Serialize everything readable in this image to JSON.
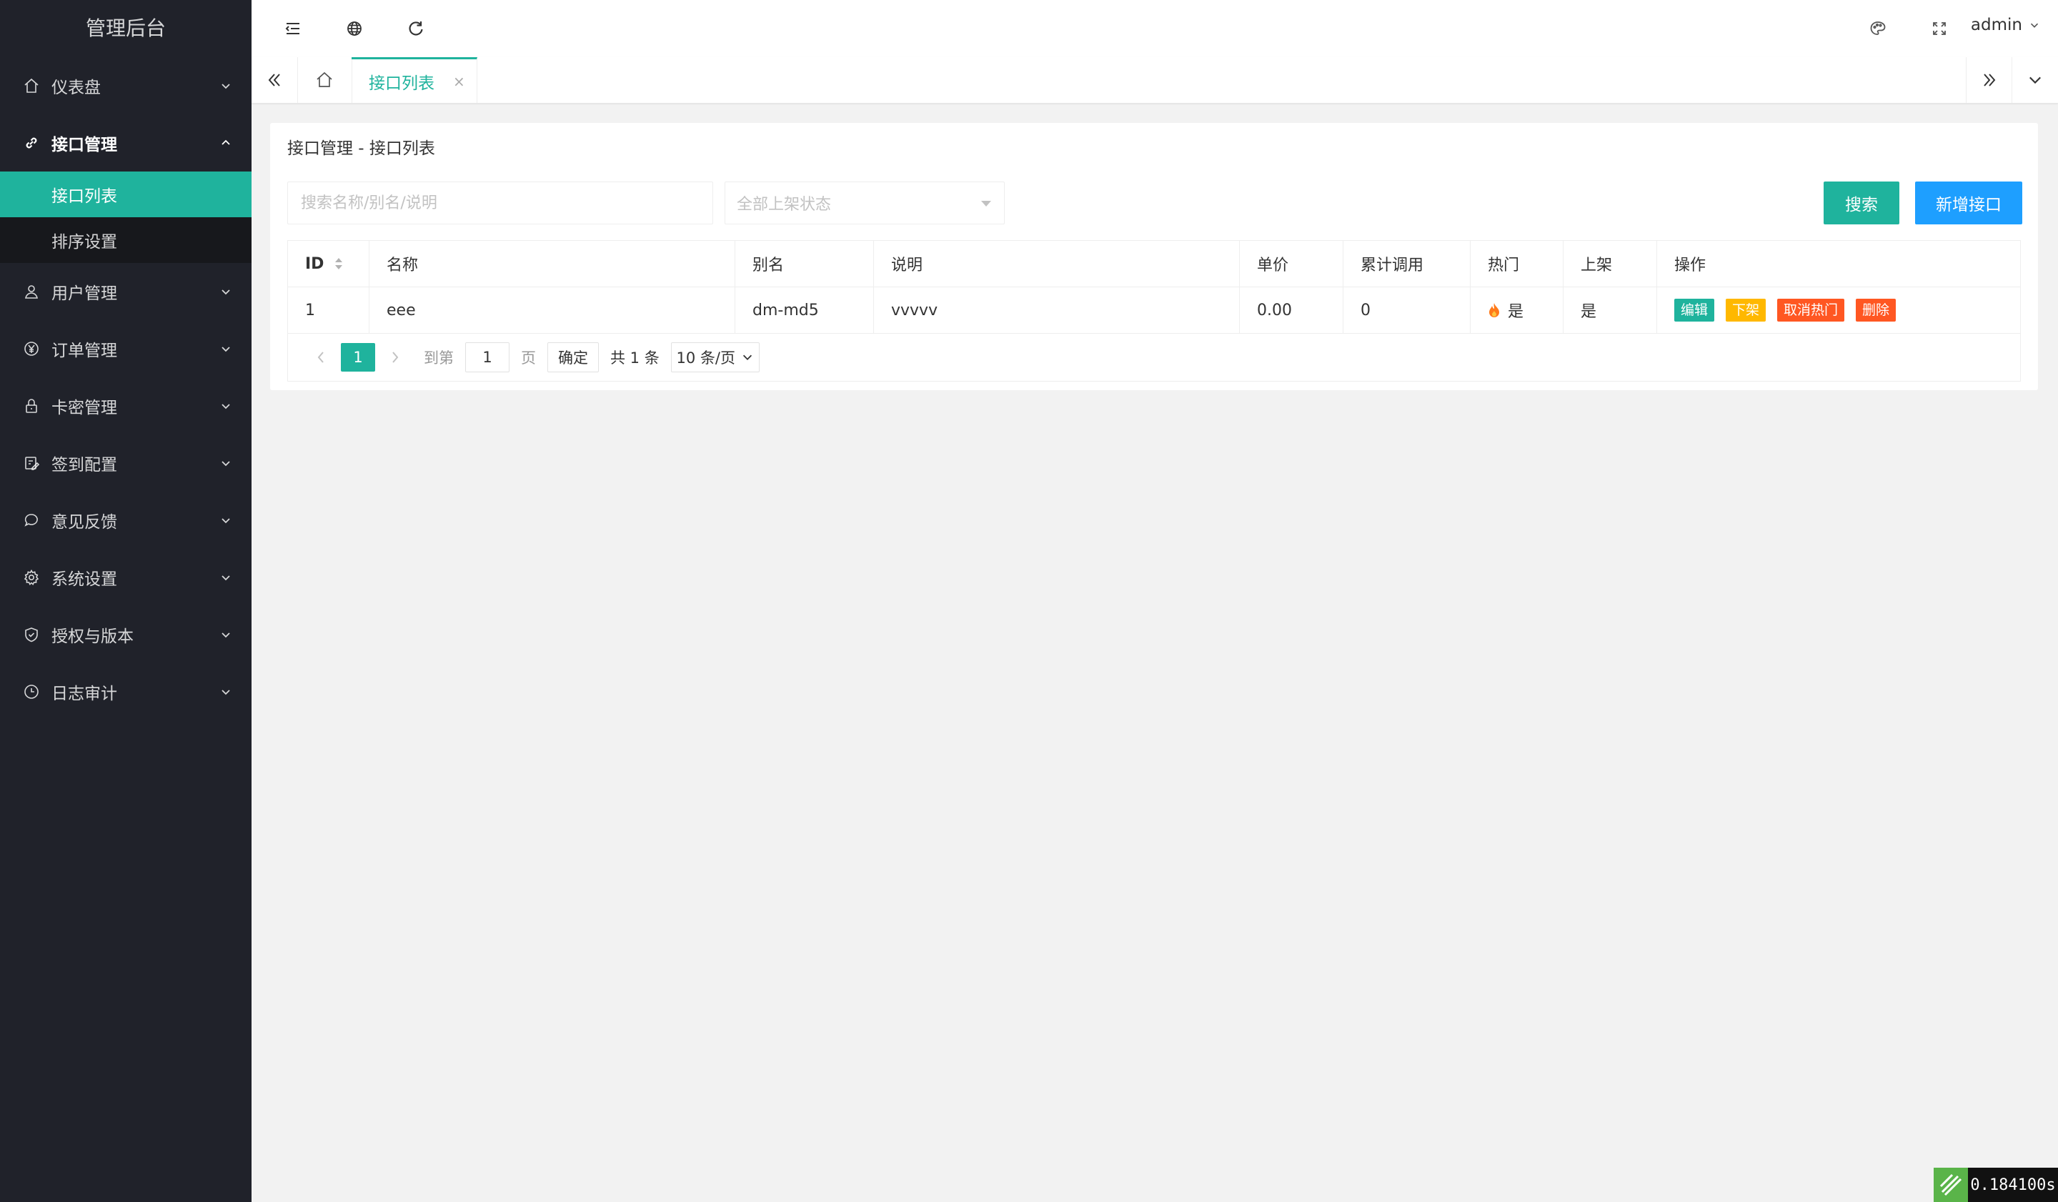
{
  "app": {
    "title": "管理后台"
  },
  "colors": {
    "accent": "#1fb39d",
    "primary": "#1e9fff",
    "warn": "#ffb800",
    "danger": "#ff5722",
    "sidebar_bg": "#20222a"
  },
  "sidebar": {
    "items": [
      {
        "label": "仪表盘",
        "icon": "home-icon"
      },
      {
        "label": "接口管理",
        "icon": "link-icon",
        "open": true,
        "children": [
          {
            "label": "接口列表",
            "active": true
          },
          {
            "label": "排序设置"
          }
        ]
      },
      {
        "label": "用户管理",
        "icon": "user-icon"
      },
      {
        "label": "订单管理",
        "icon": "yen-icon"
      },
      {
        "label": "卡密管理",
        "icon": "lock-icon"
      },
      {
        "label": "签到配置",
        "icon": "edit-icon"
      },
      {
        "label": "意见反馈",
        "icon": "chat-icon"
      },
      {
        "label": "系统设置",
        "icon": "gear-icon"
      },
      {
        "label": "授权与版本",
        "icon": "shield-icon"
      },
      {
        "label": "日志审计",
        "icon": "clock-icon"
      }
    ]
  },
  "header": {
    "user": "admin"
  },
  "tabs": {
    "active_label": "接口列表",
    "close": "×"
  },
  "main": {
    "breadcrumb": "接口管理 - 接口列表",
    "search": {
      "placeholder": "搜索名称/别名/说明",
      "status_placeholder": "全部上架状态",
      "search_label": "搜索",
      "add_label": "新增接口"
    },
    "table": {
      "headers": [
        "ID",
        "名称",
        "别名",
        "说明",
        "单价",
        "累计调用",
        "热门",
        "上架",
        "操作"
      ],
      "rows": [
        {
          "id": "1",
          "name": "eee",
          "alias": "dm-md5",
          "desc": "vvvvv",
          "price": "0.00",
          "calls": "0",
          "hot": "是",
          "listed": "是"
        }
      ],
      "actions": {
        "edit": "编辑",
        "offline": "下架",
        "unhot": "取消热门",
        "delete": "删除"
      }
    },
    "pager": {
      "current": "1",
      "goto_prefix": "到第",
      "goto_value": "1",
      "goto_suffix": "页",
      "confirm": "确定",
      "total": "共 1 条",
      "page_size": "10 条/页"
    }
  },
  "perf": {
    "time": "0.184100s"
  }
}
